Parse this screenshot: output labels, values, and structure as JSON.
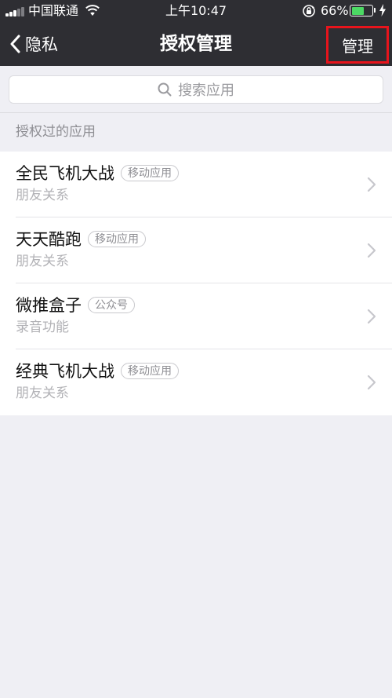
{
  "status_bar": {
    "carrier": "中国联通",
    "time": "上午10:47",
    "battery_percent_text": "66%",
    "battery_level": 0.66,
    "battery_color": "#4cd964"
  },
  "nav": {
    "back_label": "隐私",
    "title": "授权管理",
    "manage_label": "管理",
    "highlight_color": "#e8141c"
  },
  "search": {
    "placeholder": "搜索应用"
  },
  "section": {
    "header": "授权过的应用"
  },
  "apps": [
    {
      "name": "全民飞机大战",
      "tag": "移动应用",
      "permission": "朋友关系"
    },
    {
      "name": "天天酷跑",
      "tag": "移动应用",
      "permission": "朋友关系"
    },
    {
      "name": "微推盒子",
      "tag": "公众号",
      "permission": "录音功能"
    },
    {
      "name": "经典飞机大战",
      "tag": "移动应用",
      "permission": "朋友关系"
    }
  ],
  "icons": {
    "signal": "signal-icon",
    "wifi": "wifi-icon",
    "lock": "orientation-lock-icon",
    "battery": "battery-icon",
    "charging": "charging-bolt-icon",
    "back": "chevron-left-icon",
    "search": "search-icon",
    "disclosure": "chevron-right-icon"
  }
}
